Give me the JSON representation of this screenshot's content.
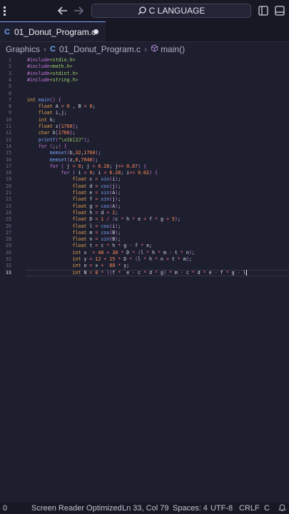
{
  "titlebar": {
    "search_text": "C LANGUAGE"
  },
  "tab": {
    "label": "01_Donut_Program.c"
  },
  "breadcrumb": {
    "folder": "Graphics",
    "file": "01_Donut_Program.c",
    "symbol": "main()"
  },
  "editor": {
    "lines": [
      "#include<stdio.h>",
      "#include<math.h>",
      "#include<stdint.h>",
      "#include<string.h>",
      "",
      "",
      "int main() {",
      "    float A = 0 , B = 0;",
      "    float i,j;",
      "    int k;",
      "    float z[1760];",
      "    char b[1760];",
      "    printf(\"\\x1b[2J\");",
      "    for (;;) {",
      "        memset(b,32,1760);",
      "        memset(z,0,7040);",
      "        for ( j = 0; j < 6.28; j+= 0.07) {",
      "            for ( i = 0; i < 6.28; i+= 0.02) {",
      "                float c = sin(i);",
      "                float d = cos(j);",
      "                float e = sin(A);",
      "                float f = sin(j);",
      "                float g = cos(A);",
      "                float h = d + 2;",
      "                float D = 1 / (c * h * e + f * g + 5);",
      "                float l = cos(i);",
      "                float m = cos(B);",
      "                float n = sin(B);",
      "                float t = c * h * g - f * e;",
      "                int x  = 40 + 30 * D * (l * h * m - t * n);",
      "                int y = 12 + 15 * D * (l * h * n + t * m);",
      "                int o = x +  80 * y;",
      "                int N = 8 * ((f *  e - c * d * g) * m - c * d * e - f * g - l"
    ]
  },
  "statusbar": {
    "problems": "0",
    "screen_reader": "Screen Reader Optimized",
    "position": "Ln 33, Col 79",
    "spaces": "Spaces: 4",
    "encoding": "UTF-8",
    "eol": "CRLF",
    "language": "C"
  },
  "colors": {
    "background": "#1e1f2e",
    "keyword": "#c678dd",
    "type": "#e5a550",
    "number": "#ff8c5a",
    "string": "#9ece6a",
    "function": "#7aa2f7",
    "operator": "#f07178",
    "text": "#d8d8e4"
  }
}
